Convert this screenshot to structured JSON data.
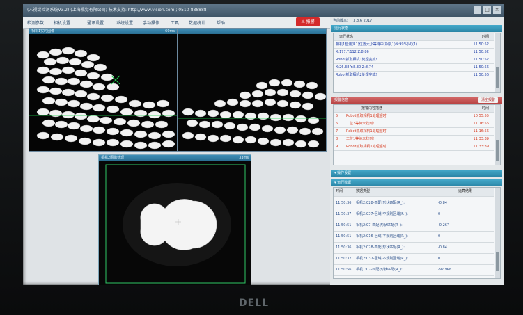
{
  "window": {
    "title": "(人视觉检测系统V3.2) (上海视觉有限公司) 技术支持: http://www.vision.com ; 0510-888888"
  },
  "menu": {
    "items": [
      "检测参数",
      "相机设置",
      "通讯设置",
      "系统设置",
      "手动操作",
      "工具",
      "数据统计",
      "帮助"
    ],
    "alarm": "报警"
  },
  "camera_panels": {
    "cam1": {
      "title": "相机1实时图像",
      "status": "60ms"
    },
    "cam2": {
      "title": "",
      "status": ""
    },
    "cam3": {
      "title": "相机2图像处理",
      "status": "33ms"
    }
  },
  "header": {
    "label": "当前版本:",
    "value": "3.8.6 2017"
  },
  "status_panel": {
    "title": "运行状态",
    "columns": [
      "运行状态",
      "时间"
    ],
    "rows": [
      {
        "text": "相机1检测(R1)位置大小等待中(相机1)N:99%(N)(1)",
        "time": "11:50:52"
      },
      {
        "text": "X:177.Y:112.Z:8.86",
        "time": "11:50:52"
      },
      {
        "text": "Robot抓取相机1处理完成!",
        "time": "11:50:52"
      },
      {
        "text": "X:26.38 Y:8.30 Z:8.74",
        "time": "11:50:56"
      },
      {
        "text": "Robot抓取相机2处理完成!",
        "time": "11:50:56"
      }
    ]
  },
  "alarm_panel": {
    "title": "报警信息",
    "clear": "清空报警",
    "columns": [
      "",
      "报警内容描述",
      "时间"
    ],
    "rows": [
      {
        "n": "5",
        "text": "Robot抓取相机1处理超时!",
        "time": "10:55:55"
      },
      {
        "n": "6",
        "text": "工位2等待未找到!",
        "time": "11:16:56"
      },
      {
        "n": "7",
        "text": "Robot抓取相机1处理超时!",
        "time": "11:16:56"
      },
      {
        "n": "8",
        "text": "工位1等待未找到!",
        "time": "11:33:39"
      },
      {
        "n": "9",
        "text": "Robot抓取相机1处理超时!",
        "time": "11:33:39"
      }
    ]
  },
  "op_panel": {
    "title": "操作设置"
  },
  "data_panel": {
    "title": "运行数据",
    "columns": [
      "时间",
      "数据类型",
      "运算结果"
    ],
    "rows": [
      {
        "time": "11:50:36",
        "type": "相机2:C28-匹配-形状匹配(R_):",
        "value": "-0.84"
      },
      {
        "time": "11:50:37",
        "type": "相机2:C37-区域-不规则区域(R_):",
        "value": "0"
      },
      {
        "time": "11:50:51",
        "type": "相机2:C7-匹配-形状匹配(R_):",
        "value": "-0.267"
      },
      {
        "time": "11:50:51",
        "type": "相机2:C16-区域-不规则区域(R_):",
        "value": "0"
      },
      {
        "time": "11:50:36",
        "type": "相机2:C28-匹配-形状匹配(R_):",
        "value": "-0.84"
      },
      {
        "time": "11:50:37",
        "type": "相机2:C37-区域-不规则区域(R_):",
        "value": "0"
      },
      {
        "time": "11:50:56",
        "type": "相机1:C7-匹配-形状匹配(R_):",
        "value": "-97.966"
      }
    ]
  },
  "brand": "DELL"
}
